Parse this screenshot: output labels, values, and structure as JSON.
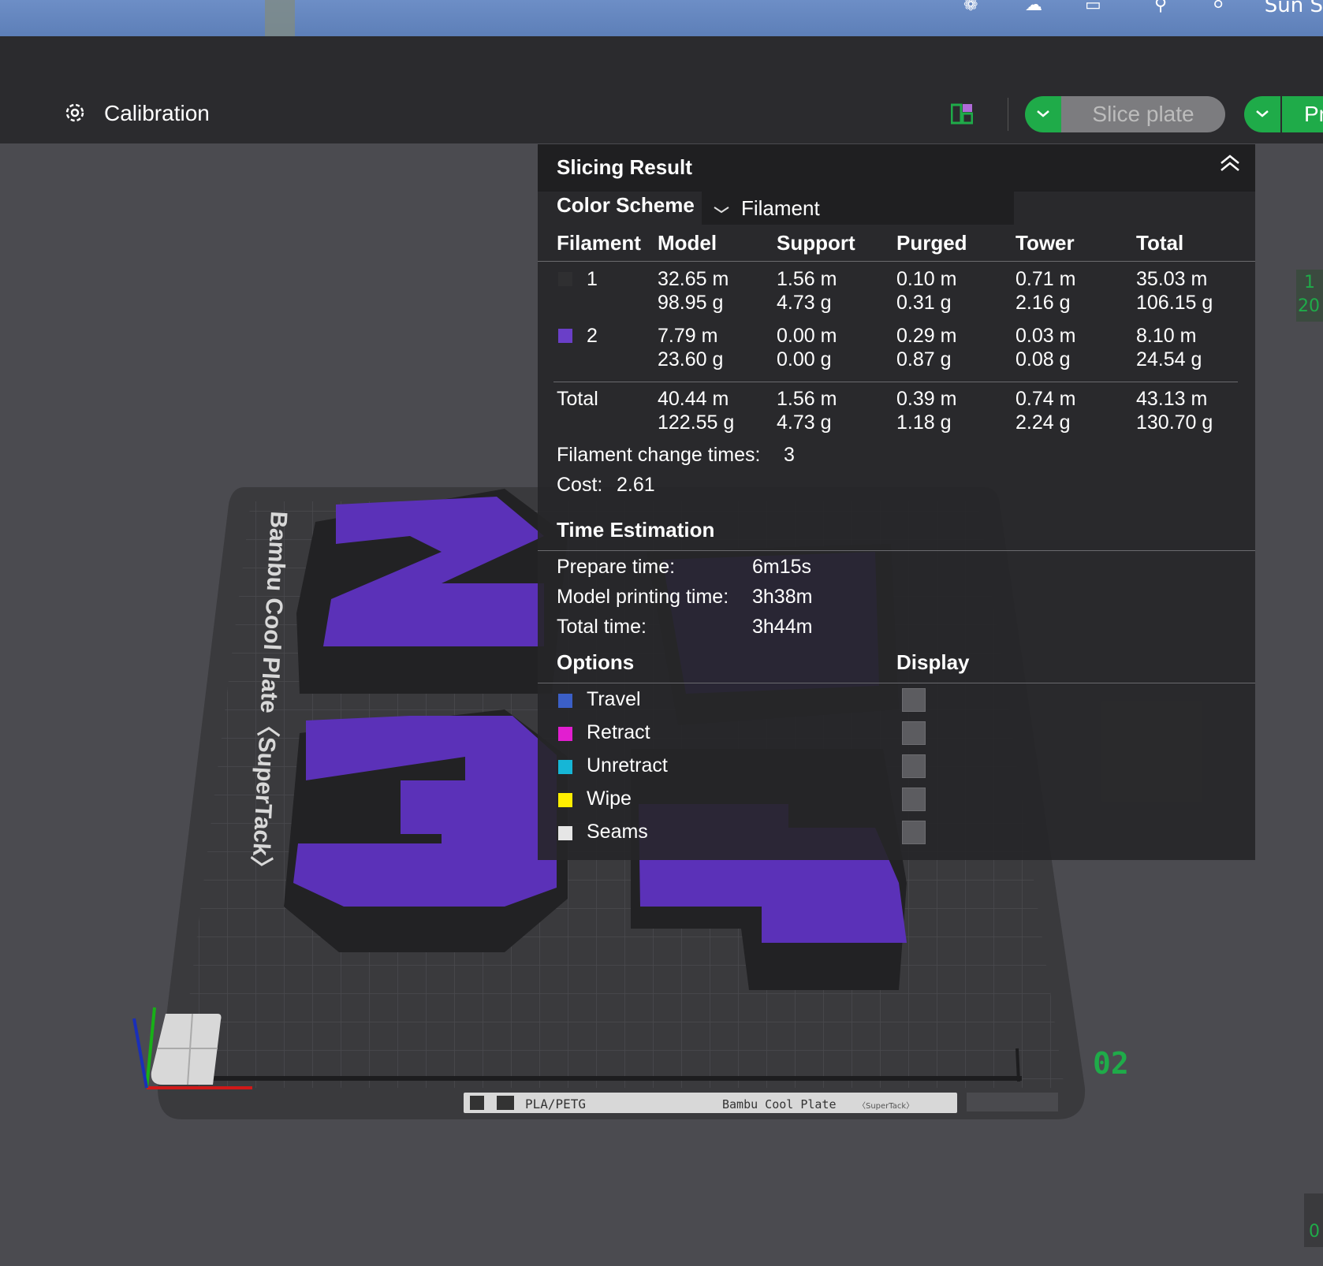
{
  "menubar": {
    "clock_partial": "Sun S"
  },
  "toolbar": {
    "calibration_label": "Calibration",
    "slice_label": "Slice plate",
    "print_label_partial": "Pr"
  },
  "panel": {
    "title": "Slicing Result",
    "color_scheme_label": "Color Scheme",
    "color_scheme_value": "Filament",
    "columns": [
      "Filament",
      "Model",
      "Support",
      "Purged",
      "Tower",
      "Total"
    ],
    "rows": [
      {
        "id": "1",
        "color": "#2f2f31",
        "model": [
          "32.65 m",
          "98.95 g"
        ],
        "support": [
          "1.56 m",
          "4.73 g"
        ],
        "purged": [
          "0.10 m",
          "0.31 g"
        ],
        "tower": [
          "0.71 m",
          "2.16 g"
        ],
        "total": [
          "35.03 m",
          "106.15 g"
        ]
      },
      {
        "id": "2",
        "color": "#6a3fc8",
        "model": [
          "7.79 m",
          "23.60 g"
        ],
        "support": [
          "0.00 m",
          "0.00 g"
        ],
        "purged": [
          "0.29 m",
          "0.87 g"
        ],
        "tower": [
          "0.03 m",
          "0.08 g"
        ],
        "total": [
          "8.10 m",
          "24.54 g"
        ]
      }
    ],
    "total_row": {
      "label": "Total",
      "model": [
        "40.44 m",
        "122.55 g"
      ],
      "support": [
        "1.56 m",
        "4.73 g"
      ],
      "purged": [
        "0.39 m",
        "1.18 g"
      ],
      "tower": [
        "0.74 m",
        "2.24 g"
      ],
      "total": [
        "43.13 m",
        "130.70 g"
      ]
    },
    "filament_change_label": "Filament change times:",
    "filament_change_value": "3",
    "cost_label": "Cost:",
    "cost_value": "2.61",
    "time_title": "Time Estimation",
    "prepare_label": "Prepare time:",
    "prepare_value": "6m15s",
    "model_time_label": "Model printing time:",
    "model_time_value": "3h38m",
    "total_time_label": "Total time:",
    "total_time_value": "3h44m",
    "options_title": "Options",
    "display_title": "Display",
    "options": [
      {
        "label": "Travel",
        "color": "#3b5fc7"
      },
      {
        "label": "Retract",
        "color": "#e21ed0"
      },
      {
        "label": "Unretract",
        "color": "#16b6d6"
      },
      {
        "label": "Wipe",
        "color": "#ffee00"
      },
      {
        "label": "Seams",
        "color": "#e6e6e6"
      }
    ]
  },
  "plate": {
    "side_label": "Bambu Cool Plate〈SuperTack〉",
    "bottom_material": "PLA/PETG",
    "bottom_plate": "Bambu Cool Plate",
    "bottom_plate_small": "〈SuperTack〉",
    "plate_number": "02"
  },
  "right_edge": {
    "top_line1": "1",
    "top_line2": "20",
    "bottom": "0"
  },
  "colors": {
    "accent": "#1fab49",
    "model_purple": "#5b31b8",
    "model_black": "#222224"
  }
}
